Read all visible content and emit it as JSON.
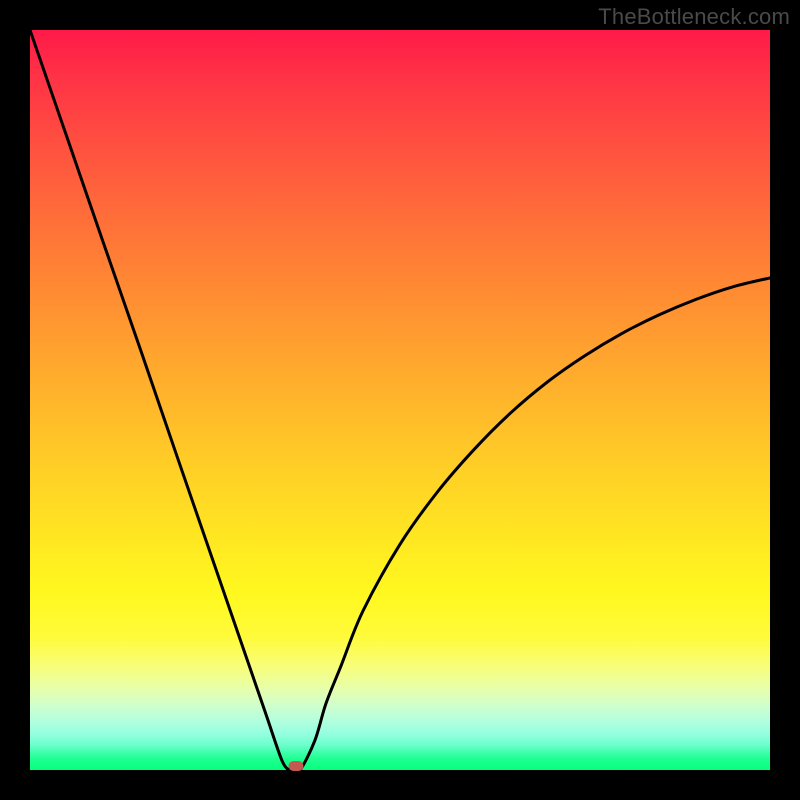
{
  "watermark": "TheBottleneck.com",
  "colors": {
    "curve_stroke": "#000000",
    "marker_fill": "#c45952",
    "frame_bg": "#000000"
  },
  "chart_data": {
    "type": "line",
    "title": "",
    "xlabel": "",
    "ylabel": "",
    "xlim": [
      0,
      100
    ],
    "ylim": [
      0,
      100
    ],
    "grid": false,
    "legend": false,
    "annotations": [],
    "series": [
      {
        "name": "curve",
        "x": [
          0,
          5,
          10,
          15,
          20,
          25,
          30,
          32,
          34,
          35,
          35.5,
          36.5,
          38.5,
          40,
          42,
          45,
          50,
          55,
          60,
          65,
          70,
          75,
          80,
          85,
          90,
          95,
          100
        ],
        "y": [
          100,
          85.5,
          71,
          56.6,
          42,
          27.5,
          13,
          7.2,
          1.4,
          0,
          0,
          0,
          4,
          9,
          14,
          21.5,
          30.5,
          37.5,
          43.3,
          48.3,
          52.5,
          56.0,
          59.0,
          61.5,
          63.6,
          65.3,
          66.5
        ]
      }
    ],
    "marker": {
      "x": 36,
      "y": 0
    }
  }
}
